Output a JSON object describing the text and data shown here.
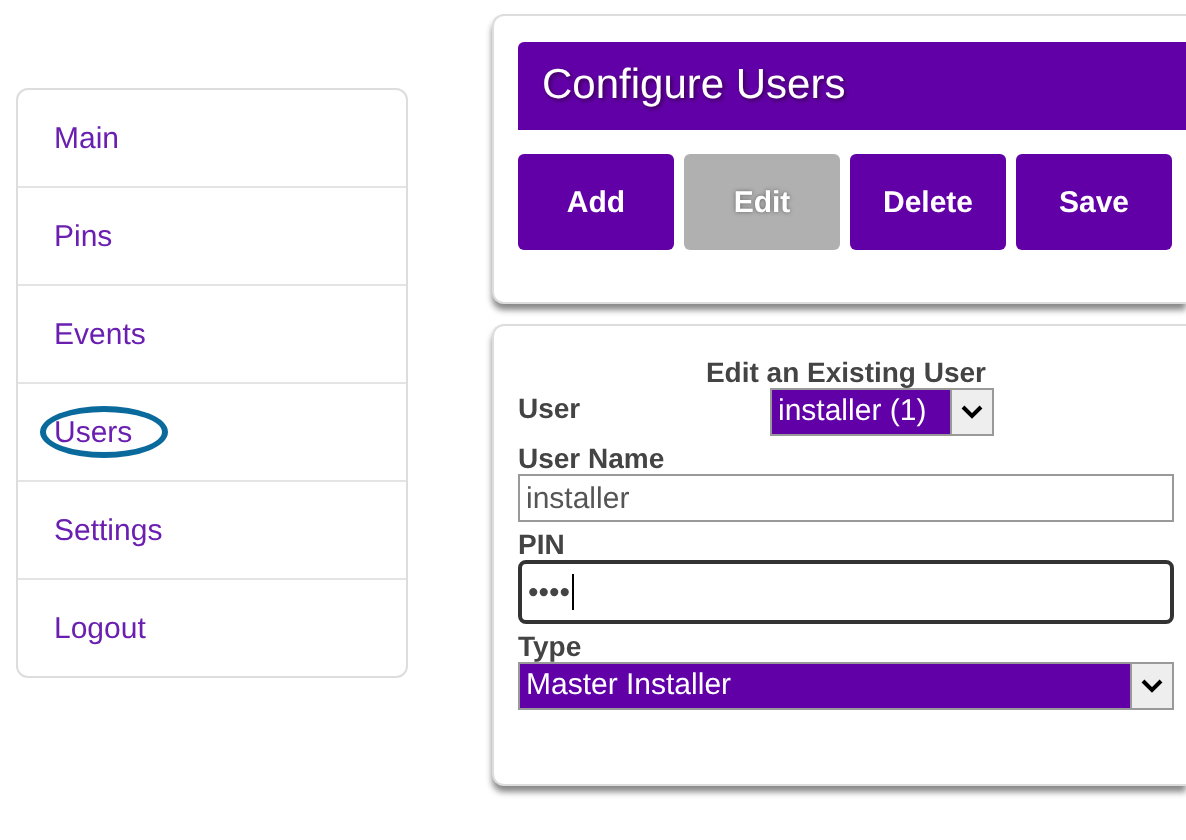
{
  "sidebar": {
    "items": [
      {
        "label": "Main",
        "circled": false
      },
      {
        "label": "Pins",
        "circled": false
      },
      {
        "label": "Events",
        "circled": false
      },
      {
        "label": "Users",
        "circled": true
      },
      {
        "label": "Settings",
        "circled": false
      },
      {
        "label": "Logout",
        "circled": false
      }
    ]
  },
  "configure": {
    "title": "Configure Users",
    "buttons": [
      {
        "label": "Add",
        "disabled": false
      },
      {
        "label": "Edit",
        "disabled": true
      },
      {
        "label": "Delete",
        "disabled": false
      },
      {
        "label": "Save",
        "disabled": false
      }
    ]
  },
  "form": {
    "heading": "Edit an Existing User",
    "fields": [
      {
        "kind": "select",
        "label": "User",
        "value": "installer (1)",
        "wide": false
      },
      {
        "kind": "text",
        "label": "User Name",
        "value": "installer",
        "focused": false
      },
      {
        "kind": "text",
        "label": "PIN",
        "value": "••••",
        "focused": true
      },
      {
        "kind": "select",
        "label": "Type",
        "value": "Master Installer",
        "wide": true
      }
    ]
  }
}
